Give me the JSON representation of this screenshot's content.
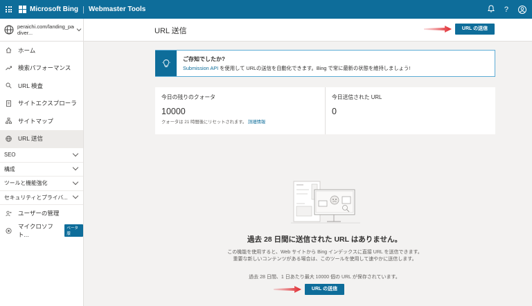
{
  "topbar": {
    "brand": "Microsoft Bing",
    "separator": "|",
    "product": "Webmaster Tools",
    "icons": [
      "waffle-icon",
      "bell-icon",
      "help-icon",
      "account-icon"
    ]
  },
  "site": {
    "url": "peraichi.com/landing_pages/view/bucho-diver..."
  },
  "nav": {
    "items": [
      {
        "label": "ホーム",
        "icon": "home-icon"
      },
      {
        "label": "検索パフォーマンス",
        "icon": "trend-icon"
      },
      {
        "label": "URL 検査",
        "icon": "search-icon"
      },
      {
        "label": "サイトエクスプローラ",
        "icon": "document-icon"
      },
      {
        "label": "サイトマップ",
        "icon": "sitemap-icon"
      },
      {
        "label": "URL 送信",
        "icon": "globe-icon"
      }
    ],
    "groups": [
      {
        "label": "SEO"
      },
      {
        "label": "構成"
      },
      {
        "label": "ツールと機能強化"
      },
      {
        "label": "セキュリティとプライバ..."
      }
    ],
    "bottom": [
      {
        "label": "ユーザーの管理",
        "icon": "users-icon"
      },
      {
        "label": "マイクロソフト...",
        "icon": "copilot-icon",
        "badge": "ベータ版"
      }
    ]
  },
  "header": {
    "title": "URL 送信",
    "submit_label": "URL の送信"
  },
  "info": {
    "title": "ご存知でしたか?",
    "link": "Submission API",
    "text": " を使用して URLの送信を自動化できます。Bing で常に最新の状態を維持しましょう!"
  },
  "quota": {
    "remaining_label": "今日の残りのクォータ",
    "remaining_value": "10000",
    "reset_text": "クォータは 21 時間後にリセットされます。",
    "details_link": "詳細情報",
    "submitted_label": "今日送信された URL",
    "submitted_value": "0"
  },
  "empty": {
    "title": "過去 28 日間に送信された URL はありません。",
    "description": "この機能を使用すると、Web サイトから Bing インデックスに直接 URL を送信できます。重要な新しいコンテンツがある場合は、このツールを使用して速やかに送信します。",
    "note": "過去 28 日間、1 日あたり最大 10000 個の URL が保存されています。",
    "submit_label": "URL の送信"
  },
  "colors": {
    "brand": "#0e6d9a",
    "arrow": "#e0282e",
    "background": "#f3f2f1"
  }
}
